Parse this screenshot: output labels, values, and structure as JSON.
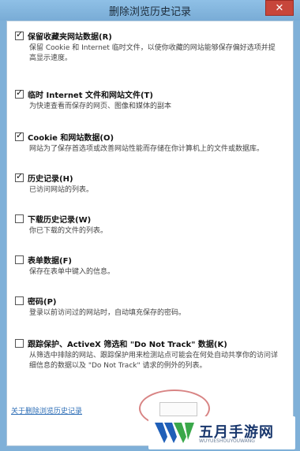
{
  "window": {
    "title": "删除浏览历史记录",
    "close_glyph": "✕"
  },
  "options": [
    {
      "title": "保留收藏夹网站数据(R)",
      "checked": true,
      "desc": "保留 Cookie 和 Internet 临时文件，以使你收藏的网站能够保存偏好选项并提高显示速度。"
    },
    {
      "title": "临时 Internet 文件和网站文件(T)",
      "checked": true,
      "desc": "为快速查看而保存的网页、图像和媒体的副本"
    },
    {
      "title": "Cookie 和网站数据(O)",
      "checked": true,
      "desc": "网站为了保存首选项或改善网站性能而存储在你计算机上的文件或数据库。"
    },
    {
      "title": "历史记录(H)",
      "checked": true,
      "desc": "已访问网站的列表。"
    },
    {
      "title": "下载历史记录(W)",
      "checked": false,
      "desc": "你已下载的文件的列表。"
    },
    {
      "title": "表单数据(F)",
      "checked": false,
      "desc": "保存在表单中键入的信息。"
    },
    {
      "title": "密码(P)",
      "checked": false,
      "desc": "登录以前访问过的网站时，自动填充保存的密码。"
    },
    {
      "title": "跟踪保护、ActiveX 筛选和 \"Do Not Track\" 数据(K)",
      "checked": false,
      "desc": "从筛选中排除的网站、跟踪保护用来检测站点可能会在何处自动共享你的访问详细信息的数据以及 \"Do Not Track\" 请求的例外的列表。"
    }
  ],
  "footer": {
    "link_label": "关于删除浏览历史记录"
  },
  "watermark": {
    "text": "五月手游网",
    "sub": "WUYUESHOUYOUWANG",
    "colors": {
      "blue": "#1f5fb8",
      "green": "#3aa84a"
    }
  }
}
